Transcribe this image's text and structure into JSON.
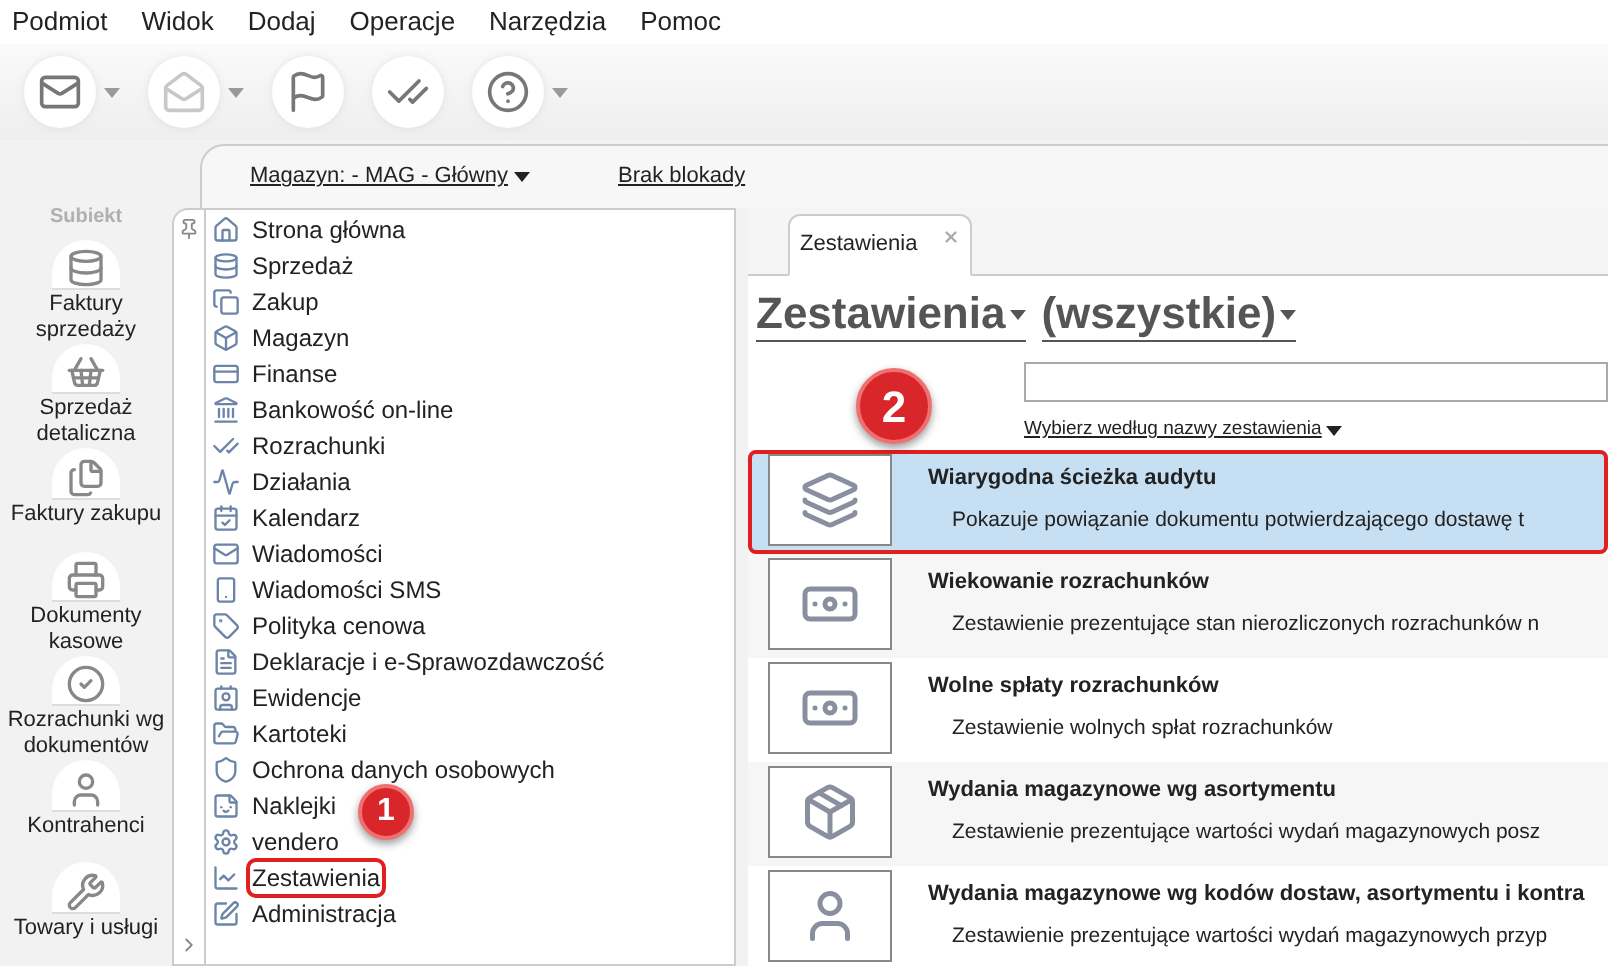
{
  "menu": [
    "Podmiot",
    "Widok",
    "Dodaj",
    "Operacje",
    "Narzędzia",
    "Pomoc"
  ],
  "toolbar": [
    {
      "dropdown": true,
      "disabled": false
    },
    {
      "dropdown": true,
      "disabled": true
    },
    {
      "dropdown": false,
      "disabled": false
    },
    {
      "dropdown": false,
      "disabled": false
    },
    {
      "dropdown": true,
      "disabled": false
    }
  ],
  "logo": {
    "text": "Subiekt"
  },
  "sidebar": {
    "items": [
      "Faktury sprzedaży",
      "Sprzedaż detaliczna",
      "Faktury zakupu",
      "Dokumenty kasowe",
      "Rozrachunki wg dokumentów",
      "Kontrahenci",
      "Towary i usługi"
    ]
  },
  "header": {
    "warehouse": "Magazyn: - MAG - Główny",
    "lock": "Brak blokady"
  },
  "tree": {
    "items": [
      {
        "label": "Strona główna",
        "highlighted": false
      },
      {
        "label": "Sprzedaż",
        "highlighted": false
      },
      {
        "label": "Zakup",
        "highlighted": false
      },
      {
        "label": "Magazyn",
        "highlighted": false
      },
      {
        "label": "Finanse",
        "highlighted": false
      },
      {
        "label": "Bankowość on-line",
        "highlighted": false
      },
      {
        "label": "Rozrachunki",
        "highlighted": false
      },
      {
        "label": "Działania",
        "highlighted": false
      },
      {
        "label": "Kalendarz",
        "highlighted": false
      },
      {
        "label": "Wiadomości",
        "highlighted": false
      },
      {
        "label": "Wiadomości SMS",
        "highlighted": false
      },
      {
        "label": "Polityka cenowa",
        "highlighted": false
      },
      {
        "label": "Deklaracje i e-Sprawozdawczość",
        "highlighted": false
      },
      {
        "label": "Ewidencje",
        "highlighted": false
      },
      {
        "label": "Kartoteki",
        "highlighted": false
      },
      {
        "label": "Ochrona danych osobowych",
        "highlighted": false
      },
      {
        "label": "Naklejki",
        "highlighted": false
      },
      {
        "label": "vendero",
        "highlighted": false
      },
      {
        "label": "Zestawienia",
        "highlighted": true
      },
      {
        "label": "Administracja",
        "highlighted": false
      }
    ]
  },
  "tabs": [
    {
      "label": "Zestawienia",
      "selected": true
    }
  ],
  "title": {
    "category": "Zestawienia",
    "filter": "(wszystkie)"
  },
  "search": {
    "mode": "Wybierz według nazwy zestawienia"
  },
  "reports": [
    {
      "title": "Wiarygodna ścieżka audytu",
      "description": "Pokazuje powiązanie dokumentu potwierdzającego dostawę t",
      "selected": true,
      "highlighted": true
    },
    {
      "title": "Wiekowanie rozrachunków",
      "description": "Zestawienie prezentujące stan nierozliczonych rozrachunków n",
      "selected": false,
      "highlighted": false
    },
    {
      "title": "Wolne spłaty rozrachunków",
      "description": "Zestawienie wolnych spłat rozrachunków",
      "selected": false,
      "highlighted": false
    },
    {
      "title": "Wydania magazynowe wg asortymentu",
      "description": "Zestawienie prezentujące wartości wydań magazynowych posz",
      "selected": false,
      "highlighted": false
    },
    {
      "title": "Wydania magazynowe wg kodów dostaw, asortymentu i kontra",
      "description": "Zestawienie prezentujące wartości wydań magazynowych przyp",
      "selected": false,
      "highlighted": false
    }
  ],
  "annotations": [
    {
      "label": "1"
    },
    {
      "label": "2"
    }
  ]
}
